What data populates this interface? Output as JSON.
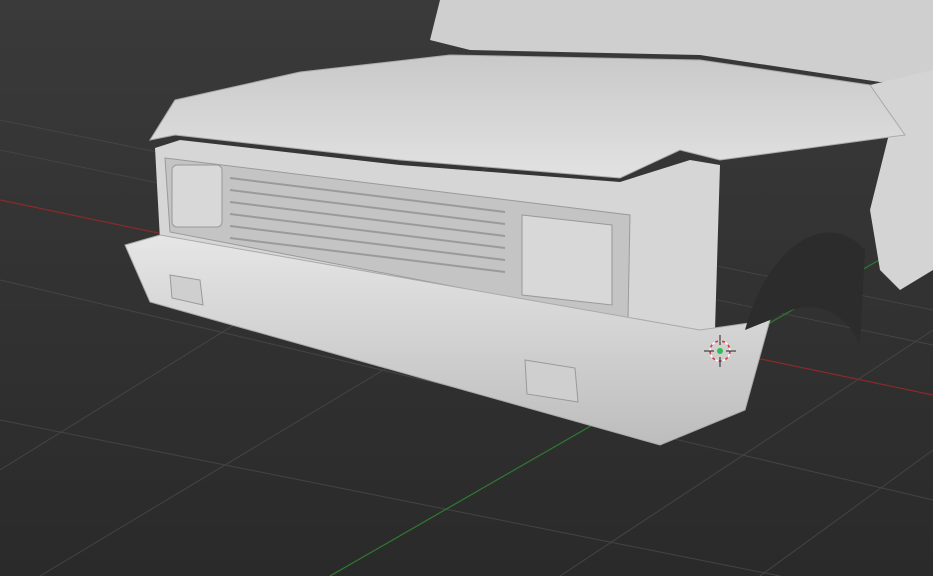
{
  "viewport": {
    "view": "3d-perspective",
    "object": "truck-front-model",
    "colors": {
      "background": "#2e2e2e",
      "grid": "#3f3f3f",
      "x_axis": "#8a2a2a",
      "y_axis": "#2f7a2f",
      "model": "#d9d9d9",
      "cursor_ring": "#e03030",
      "cursor_center": "#2fbf4f"
    }
  }
}
